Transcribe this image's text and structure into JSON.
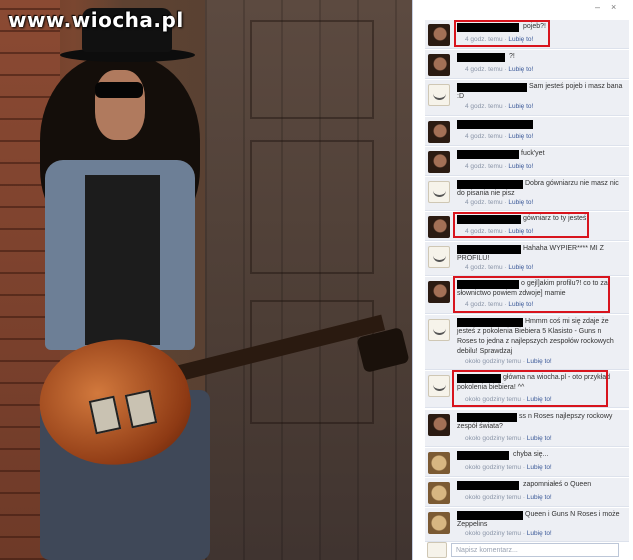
{
  "watermark": "www.wiocha.pl",
  "panel": {
    "minimize": "–",
    "close": "×"
  },
  "comments": [
    {
      "text": "pojeb?!",
      "time": "4 godz. temu",
      "like": "Lubię to!",
      "avatar": "slash"
    },
    {
      "text": "?!",
      "time": "4 godz. temu",
      "like": "Lubię to!",
      "avatar": "slash"
    },
    {
      "text": "Sam jesteś pojeb i masz bana :D",
      "time": "4 godz. temu",
      "like": "Lubię to!",
      "avatar": "troll"
    },
    {
      "text": "",
      "time": "4 godz. temu",
      "like": "Lubię to!",
      "avatar": "slash"
    },
    {
      "text": "fuck'yet",
      "time": "4 godz. temu",
      "like": "Lubię to!",
      "avatar": "slash"
    },
    {
      "text": "Dobra gówniarzu nie masz nic do pisania nie pisz",
      "time": "4 godz. temu",
      "like": "Lubię to!",
      "avatar": "troll"
    },
    {
      "text": "gówniarz to ty jesteś",
      "time": "4 godz. temu",
      "like": "Lubię to!",
      "avatar": "slash"
    },
    {
      "text": "Hahaha WYPIER**** MI Z PROFILU!",
      "time": "4 godz. temu",
      "like": "Lubię to!",
      "avatar": "troll"
    },
    {
      "text": "o gejl]akim profilu?! co to za słownictwo powiem zdwoje] mamie",
      "time": "4 godz. temu",
      "like": "Lubię to!",
      "avatar": "slash"
    },
    {
      "text": "Hmmm coś mi się zdaje że jesteś z pokolenia Biebiera 5 Klasisto - Guns n Roses to jedna z najlepszych zespołów rockowych debilu! Sprawdzaj",
      "time": "około godziny temu",
      "like": "Lubię to!",
      "avatar": "troll"
    },
    {
      "text": "główna na wiocha.pl - oto przykład pokolenia biebiera! ^^",
      "time": "około godziny temu",
      "like": "Lubię to!",
      "avatar": "troll"
    },
    {
      "text": "ss n Roses najlepszy rockowy zespół świata?",
      "time": "około godziny temu",
      "like": "Lubię to!",
      "avatar": "slash"
    },
    {
      "text": "chyba się...",
      "time": "około godziny temu",
      "like": "Lubię to!",
      "avatar": "blond"
    },
    {
      "text": "zapomniałeś o Queen",
      "time": "około godziny temu",
      "like": "Lubię to!",
      "avatar": "blond"
    },
    {
      "text": "Queen i Guns N Roses i może Zeppelins",
      "time": "około godziny temu",
      "like": "Lubię to!",
      "avatar": "blond"
    }
  ],
  "input_placeholder": "Napisz komentarz..."
}
